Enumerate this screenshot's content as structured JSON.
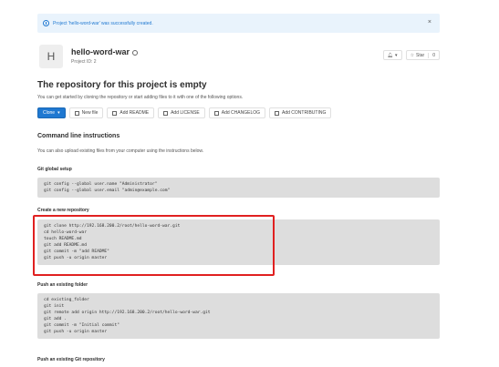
{
  "flash": {
    "message": "Project 'hello-word-war' was successfully created.",
    "close": "×"
  },
  "project": {
    "avatar_letter": "H",
    "name": "hello-word-war",
    "id_label": "Project ID: 2"
  },
  "header_actions": {
    "notify_label": "▾",
    "star_label": "Star",
    "star_count": "0"
  },
  "empty": {
    "title": "The repository for this project is empty",
    "description": "You can get started by cloning the repository or start adding files to it with one of the following options."
  },
  "buttons": {
    "clone": "Clone",
    "new_file": "New file",
    "add_readme": "Add README",
    "add_license": "Add LICENSE",
    "add_changelog": "Add CHANGELOG",
    "add_contributing": "Add CONTRIBUTING"
  },
  "cli": {
    "title": "Command line instructions",
    "description": "You can also upload existing files from your computer using the instructions below."
  },
  "sections": [
    {
      "heading": "Git global setup",
      "lines": [
        "git config --global user.name \"Administrator\"",
        "git config --global user.email \"admin@example.com\""
      ]
    },
    {
      "heading": "Create a new repository",
      "lines": [
        "git clone http://192.168.200.2/root/hello-word-war.git",
        "cd hello-word-war",
        "touch README.md",
        "git add README.md",
        "git commit -m \"add README\"",
        "git push -u origin master"
      ]
    },
    {
      "heading": "Push an existing folder",
      "lines": [
        "cd existing_folder",
        "git init",
        "git remote add origin http://192.168.200.2/root/hello-word-war.git",
        "git add .",
        "git commit -m \"Initial commit\"",
        "git push -u origin master"
      ]
    },
    {
      "heading": "Push an existing Git repository"
    }
  ],
  "colors": {
    "accent": "#1f78d1",
    "highlight": "#e02020",
    "code_bg": "#dddddd"
  }
}
